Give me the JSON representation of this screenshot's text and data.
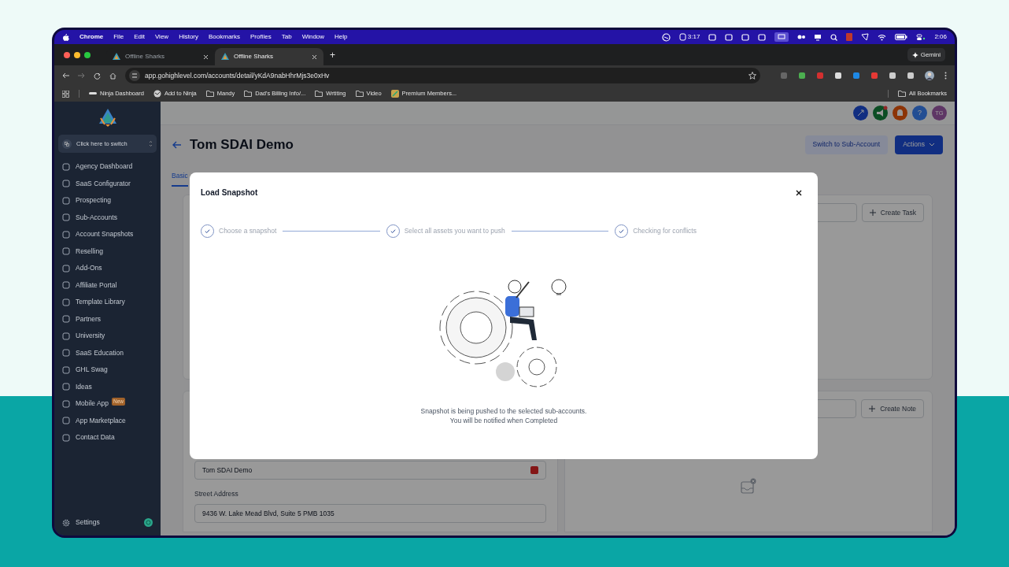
{
  "menu_bar": {
    "items": [
      "Chrome",
      "File",
      "Edit",
      "View",
      "History",
      "Bookmarks",
      "Profiles",
      "Tab",
      "Window",
      "Help"
    ],
    "timer": "3:17",
    "clock": "2:06"
  },
  "browser": {
    "tabs": [
      {
        "title": "Offline Sharks",
        "selected": false
      },
      {
        "title": "Offline Sharks",
        "selected": true
      }
    ],
    "new_tab": "+",
    "gemini": "Gemini",
    "address": "app.gohighlevel.com/accounts/detail/yKdA9nabHhrMjs3e0xHv",
    "bookmarks": [
      {
        "label": "Ninja Dashboard",
        "kind": "dash"
      },
      {
        "label": "Add to Ninja",
        "kind": "globe"
      },
      {
        "label": "Mandy",
        "kind": "folder"
      },
      {
        "label": "Dad's Billing Info/...",
        "kind": "folder"
      },
      {
        "label": "Wrtiting",
        "kind": "folder"
      },
      {
        "label": "Video",
        "kind": "folder"
      },
      {
        "label": "Premium Members...",
        "kind": "site"
      }
    ],
    "all_bookmarks": "All Bookmarks"
  },
  "sidebar": {
    "switcher": "Click here to switch",
    "items": [
      {
        "label": "Agency Dashboard"
      },
      {
        "label": "SaaS Configurator"
      },
      {
        "label": "Prospecting"
      },
      {
        "label": "Sub-Accounts"
      },
      {
        "label": "Account Snapshots"
      },
      {
        "label": "Reselling"
      },
      {
        "label": "Add-Ons"
      },
      {
        "label": "Affiliate Portal"
      },
      {
        "label": "Template Library"
      },
      {
        "label": "Partners"
      },
      {
        "label": "University"
      },
      {
        "label": "SaaS Education"
      },
      {
        "label": "GHL Swag"
      },
      {
        "label": "Ideas"
      },
      {
        "label": "Mobile App",
        "badge": "New"
      },
      {
        "label": "App Marketplace"
      },
      {
        "label": "Contact Data"
      }
    ],
    "settings": "Settings"
  },
  "header": {
    "help": "?",
    "avatar": "TG"
  },
  "page": {
    "title": "Tom SDAI Demo",
    "buttons": [
      {
        "label": "Switch to Sub-Account",
        "kind": "secondary"
      },
      {
        "label": "Actions",
        "kind": "primary"
      }
    ],
    "tabs": [
      {
        "label": "Basic",
        "selected": true
      }
    ],
    "create_task": "Create Task",
    "create_note": "Create Note",
    "fields": [
      {
        "value": "Tom SDAI Demo"
      },
      {
        "label": "Street Address",
        "value": "9436 W. Lake Mead Blvd, Suite 5 PMB 1035"
      }
    ]
  },
  "modal": {
    "title": "Load Snapshot",
    "steps": [
      {
        "label": "Choose a snapshot",
        "done": true
      },
      {
        "label": "Select all assets you want to push",
        "done": true
      },
      {
        "label": "Checking for conflicts",
        "done": true
      }
    ],
    "message": [
      "Snapshot is being pushed to the selected sub-accounts.",
      "You will be notified when Completed"
    ]
  }
}
